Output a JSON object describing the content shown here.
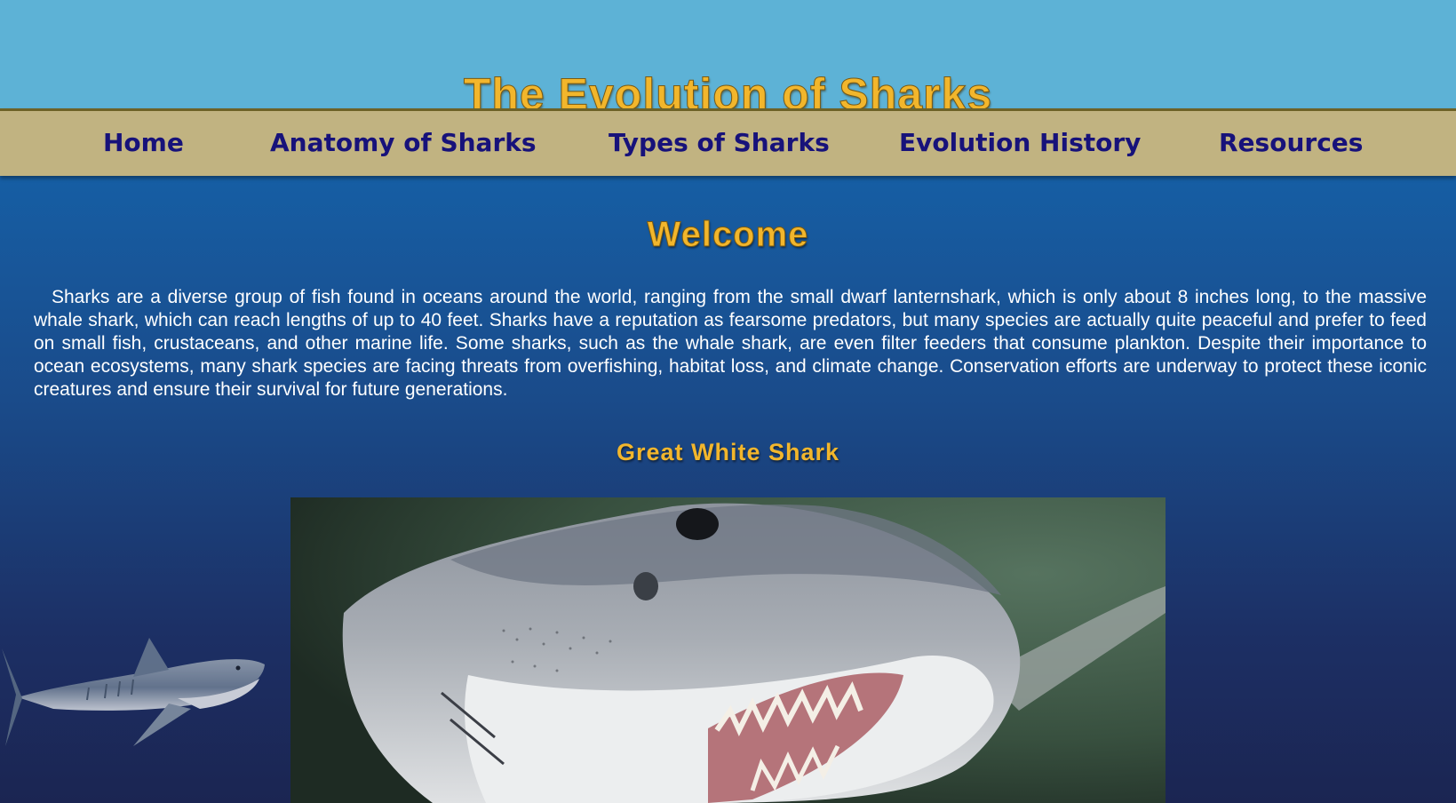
{
  "site": {
    "title": "The Evolution of Sharks"
  },
  "nav": {
    "items": [
      {
        "label": "Home"
      },
      {
        "label": "Anatomy of Sharks"
      },
      {
        "label": "Types of Sharks"
      },
      {
        "label": "Evolution History"
      },
      {
        "label": "Resources"
      }
    ]
  },
  "main": {
    "heading": "Welcome",
    "intro": "Sharks are a diverse group of fish found in oceans around the world, ranging from the small dwarf lanternshark, which is only about 8 inches long, to the massive whale shark, which can reach lengths of up to 40 feet. Sharks have a reputation as fearsome predators, but many species are actually quite peaceful and prefer to feed on small fish, crustaceans, and other marine life. Some sharks, such as the whale shark, are even filter feeders that consume plankton. Despite their importance to ocean ecosystems, many shark species are facing threats from overfishing, habitat loss, and climate change. Conservation efforts are underway to protect these iconic creatures and ensure their survival for future generations.",
    "section": {
      "title": "Great White Shark",
      "image": "great-white-shark-photo"
    },
    "decoration": "tiger-shark-image"
  },
  "colors": {
    "header_bg": "#5db2d6",
    "nav_bg": "#c1b381",
    "nav_text": "#17127a",
    "title_gold": "#f2b62c",
    "body_text": "#ffffff"
  }
}
